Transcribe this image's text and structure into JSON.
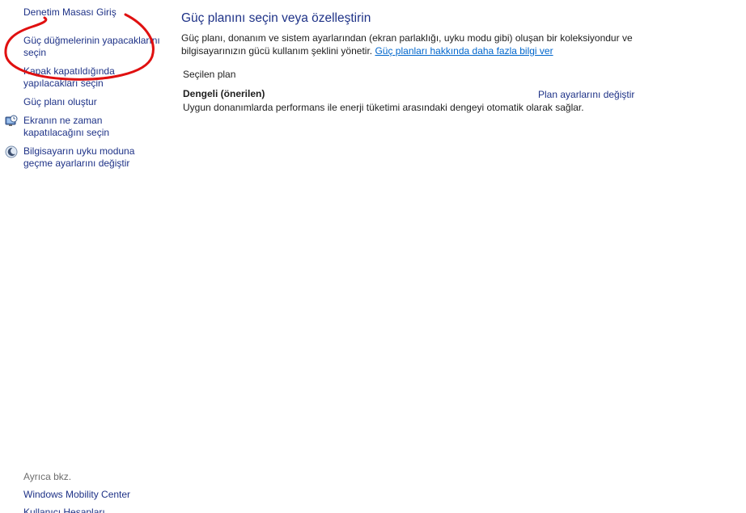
{
  "sidebar": {
    "home_link": "Denetim Masası Giriş",
    "tasks": [
      {
        "label": "Güç düğmelerinin yapacaklarını seçin",
        "icon": "none"
      },
      {
        "label": "Kapak kapatıldığında yapılacakları seçin",
        "icon": "none"
      },
      {
        "label": "Güç planı oluştur",
        "icon": "none"
      },
      {
        "label": "Ekranın ne zaman kapatılacağını seçin",
        "icon": "display-clock-icon"
      },
      {
        "label": "Bilgisayarın uyku moduna geçme ayarlarını değiştir",
        "icon": "moon-sleep-icon"
      }
    ],
    "see_also_label": "Ayrıca bkz.",
    "see_also": [
      {
        "label": "Windows Mobility Center"
      },
      {
        "label": "Kullanıcı Hesapları"
      }
    ]
  },
  "main": {
    "title": "Güç planını seçin veya özelleştirin",
    "intro_text": "Güç planı, donanım ve sistem ayarlarından (ekran parlaklığı, uyku modu gibi) oluşan bir koleksiyondur ve bilgisayarınızın gücü kullanım şeklini yönetir.",
    "intro_link": "Güç planları hakkında daha fazla bilgi ver",
    "section_label": "Seçilen plan",
    "plan": {
      "name": "Dengeli (önerilen)",
      "description": "Uygun donanımlarda performans ile enerji tüketimi arasındaki dengeyi otomatik olarak sağlar.",
      "settings_link": "Plan ayarlarını değiştir"
    }
  },
  "colors": {
    "link": "#1e3287",
    "hyperlink": "#0066cc",
    "annotation": "#e01010"
  }
}
